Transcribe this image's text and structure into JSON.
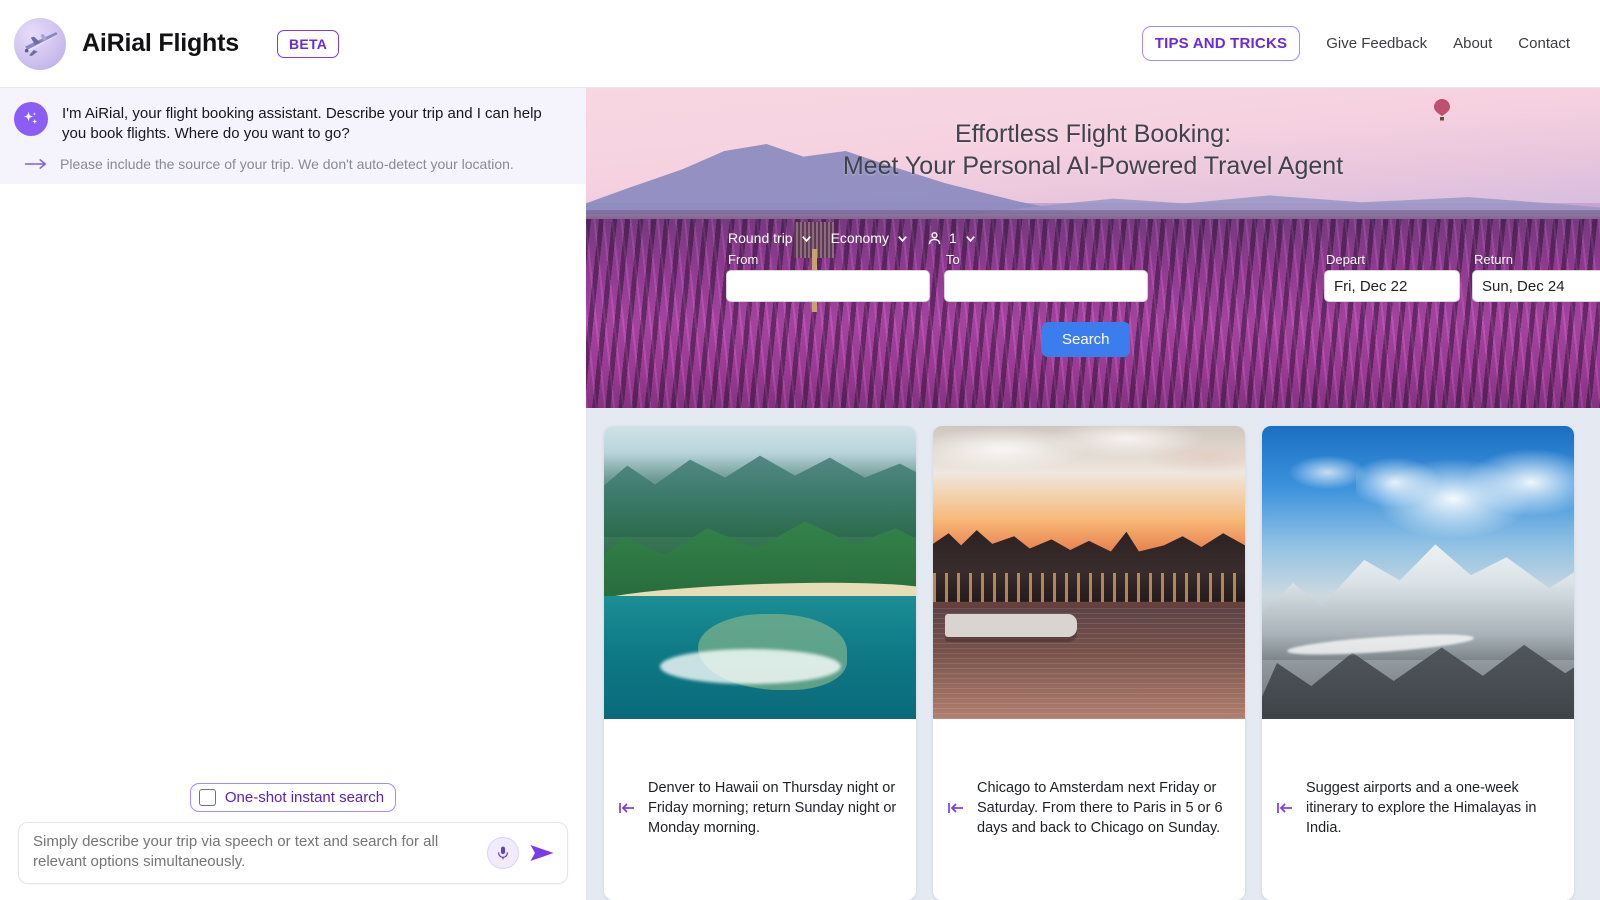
{
  "header": {
    "brand_name": "AiRial Flights",
    "beta_label": "BETA",
    "logo_icon": "airplane-icon",
    "tips_label": "TIPS AND TRICKS",
    "nav": [
      {
        "label": "Give Feedback"
      },
      {
        "label": "About"
      },
      {
        "label": "Contact"
      }
    ]
  },
  "chat": {
    "assistant_avatar_icon": "sparkles-icon",
    "assistant_message": "I'm AiRial, your flight booking assistant. Describe your trip and I can help you book flights. Where do you want to go?",
    "hint_arrow_icon": "arrow-right-icon",
    "hint_text": "Please include the source of your trip. We don't auto-detect your location.",
    "oneshot_label": "One-shot instant search",
    "oneshot_checked": false,
    "composer_placeholder": "Simply describe your trip via speech or text and search for all relevant options simultaneously.",
    "composer_value": "",
    "mic_icon": "microphone-icon",
    "send_icon": "send-icon"
  },
  "hero": {
    "title_line1": "Effortless Flight Booking:",
    "title_line2": "Meet Your Personal AI-Powered Travel Agent",
    "background_image": "lavender-field-at-dusk-photo"
  },
  "search_form": {
    "trip_type": "Round trip",
    "cabin_class": "Economy",
    "passengers": "1",
    "passenger_icon": "person-icon",
    "chevron_icon": "chevron-down-icon",
    "from_label": "From",
    "from_value": "",
    "from_placeholder": "",
    "to_label": "To",
    "to_value": "",
    "to_placeholder": "",
    "depart_label": "Depart",
    "depart_value": "Fri, Dec 22",
    "return_label": "Return",
    "return_value": "Sun, Dec 24",
    "search_label": "Search",
    "search_color": "#3b7ded"
  },
  "suggestion_cards": [
    {
      "image": "hawaii-aerial-coastline-photo",
      "icon": "skip-back-icon",
      "text": "Denver to Hawaii on Thursday night or Friday morning; return Sunday night or Monday morning."
    },
    {
      "image": "amsterdam-canal-sunset-photo",
      "icon": "skip-back-icon",
      "text": "Chicago to Amsterdam next Friday or Saturday. From there to Paris in 5 or 6 days and back to Chicago on Sunday."
    },
    {
      "image": "himalayas-snow-peaks-photo",
      "icon": "skip-back-icon",
      "text": "Suggest airports and a one-week itinerary to explore the Himalayas in India."
    }
  ],
  "colors": {
    "brand_purple": "#7c3aed",
    "accent_violet": "#8b5cf6",
    "search_blue": "#3b7ded",
    "page_bg": "#e4e9f2",
    "assistant_bg": "#f5f3fb"
  }
}
